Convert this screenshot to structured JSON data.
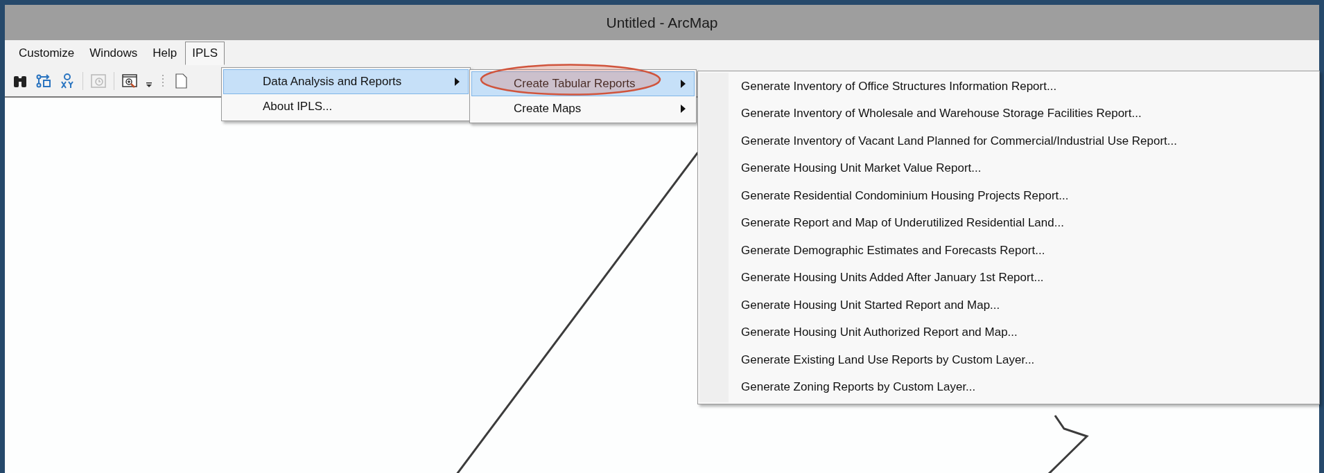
{
  "window": {
    "title": "Untitled - ArcMap"
  },
  "menubar": [
    {
      "label": "Customize",
      "selected": false
    },
    {
      "label": "Windows",
      "selected": false
    },
    {
      "label": "Help",
      "selected": false
    },
    {
      "label": "IPLS",
      "selected": true
    }
  ],
  "ipls_menu": [
    {
      "label": "Data Analysis and Reports",
      "selected": true,
      "has_submenu": true
    },
    {
      "label": "About IPLS...",
      "selected": false,
      "has_submenu": false
    }
  ],
  "reports_menu": [
    {
      "label": "Create Tabular Reports",
      "selected": true,
      "has_submenu": true,
      "highlighted": true
    },
    {
      "label": "Create Maps",
      "selected": false,
      "has_submenu": true,
      "highlighted": false
    }
  ],
  "tabular_reports_menu": [
    {
      "label": "Generate Inventory of Office Structures Information Report..."
    },
    {
      "label": "Generate Inventory of Wholesale and Warehouse Storage Facilities Report..."
    },
    {
      "label": "Generate Inventory of Vacant Land Planned for Commercial/Industrial Use Report..."
    },
    {
      "label": "Generate Housing Unit Market Value Report..."
    },
    {
      "label": "Generate Residential Condominium Housing Projects Report..."
    },
    {
      "label": "Generate Report and Map of Underutilized Residential Land..."
    },
    {
      "label": "Generate Demographic Estimates and Forecasts Report..."
    },
    {
      "label": "Generate Housing Units Added After January 1st Report..."
    },
    {
      "label": "Generate Housing Unit Started Report and Map..."
    },
    {
      "label": "Generate Housing Unit Authorized Report and Map..."
    },
    {
      "label": "Generate Existing Land Use Reports by Custom Layer..."
    },
    {
      "label": "Generate Zoning Reports by Custom Layer..."
    }
  ]
}
